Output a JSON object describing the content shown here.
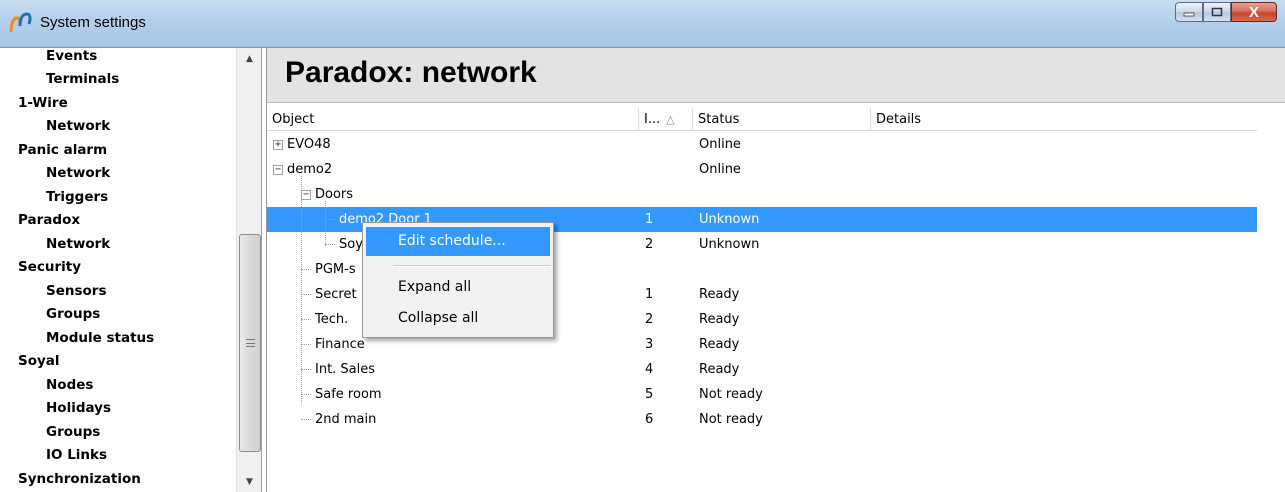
{
  "window": {
    "title": "System settings",
    "close_glyph": "X"
  },
  "nav": {
    "items": [
      {
        "label": "Events",
        "level": 2
      },
      {
        "label": "Terminals",
        "level": 2
      },
      {
        "label": "1-Wire",
        "level": 1
      },
      {
        "label": "Network",
        "level": 2
      },
      {
        "label": "Panic alarm",
        "level": 1
      },
      {
        "label": "Network",
        "level": 2
      },
      {
        "label": "Triggers",
        "level": 2
      },
      {
        "label": "Paradox",
        "level": 1
      },
      {
        "label": "Network",
        "level": 2
      },
      {
        "label": "Security",
        "level": 1
      },
      {
        "label": "Sensors",
        "level": 2
      },
      {
        "label": "Groups",
        "level": 2
      },
      {
        "label": "Module status",
        "level": 2
      },
      {
        "label": "Soyal",
        "level": 1
      },
      {
        "label": "Nodes",
        "level": 2
      },
      {
        "label": "Holidays",
        "level": 2
      },
      {
        "label": "Groups",
        "level": 2
      },
      {
        "label": "IO Links",
        "level": 2
      },
      {
        "label": "Synchronization",
        "level": 1
      }
    ]
  },
  "page": {
    "title": "Paradox: network"
  },
  "grid": {
    "columns": {
      "object": "Object",
      "id": "I...",
      "status": "Status",
      "details": "Details"
    },
    "sort_indicator": "△",
    "rows": [
      {
        "object": "EVO48",
        "id": "",
        "status": "Online"
      },
      {
        "object": "demo2",
        "id": "",
        "status": "Online"
      },
      {
        "object": "Doors",
        "id": "",
        "status": ""
      },
      {
        "object": "demo2 Door 1",
        "id": "1",
        "status": "Unknown"
      },
      {
        "object": "Soy",
        "id": "2",
        "status": "Unknown"
      },
      {
        "object": "PGM-s",
        "id": "",
        "status": ""
      },
      {
        "object": "Secret",
        "id": "1",
        "status": "Ready"
      },
      {
        "object": "Tech.",
        "id": "2",
        "status": "Ready"
      },
      {
        "object": "Finance",
        "id": "3",
        "status": "Ready"
      },
      {
        "object": "Int. Sales",
        "id": "4",
        "status": "Ready"
      },
      {
        "object": "Safe room",
        "id": "5",
        "status": "Not ready"
      },
      {
        "object": "2nd main",
        "id": "6",
        "status": "Not ready"
      }
    ],
    "toggles": {
      "collapsed": "+",
      "expanded": "−"
    }
  },
  "context_menu": {
    "edit_schedule": "Edit schedule...",
    "expand_all": "Expand all",
    "collapse_all": "Collapse all"
  },
  "colors": {
    "selection": "#3399ff"
  }
}
